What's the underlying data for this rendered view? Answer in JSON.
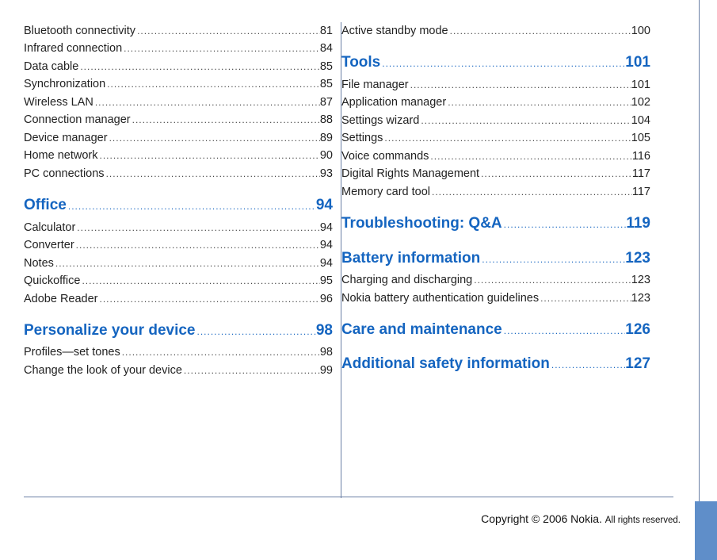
{
  "columns": [
    [
      {
        "label": "Bluetooth connectivity",
        "page": "81"
      },
      {
        "label": "Infrared connection",
        "page": "84"
      },
      {
        "label": "Data cable",
        "page": "85"
      },
      {
        "label": "Synchronization",
        "page": "85"
      },
      {
        "label": "Wireless LAN",
        "page": "87"
      },
      {
        "label": "Connection manager",
        "page": "88"
      },
      {
        "label": "Device manager",
        "page": "89"
      },
      {
        "label": "Home network",
        "page": "90"
      },
      {
        "label": "PC connections",
        "page": "93"
      },
      {
        "label": "Office",
        "page": "94",
        "section": true
      },
      {
        "label": "Calculator",
        "page": "94"
      },
      {
        "label": "Converter",
        "page": "94"
      },
      {
        "label": "Notes",
        "page": "94"
      },
      {
        "label": "Quickoffice",
        "page": "95"
      },
      {
        "label": "Adobe Reader",
        "page": "96"
      },
      {
        "label": "Personalize your device",
        "page": "98",
        "section": true
      },
      {
        "label": "Profiles—set tones",
        "page": "98"
      },
      {
        "label": "Change the look of your device",
        "page": "99"
      }
    ],
    [
      {
        "label": "Active standby mode",
        "page": "100"
      },
      {
        "label": "Tools",
        "page": "101",
        "section": true
      },
      {
        "label": "File manager",
        "page": "101"
      },
      {
        "label": "Application manager",
        "page": "102"
      },
      {
        "label": "Settings wizard",
        "page": "104"
      },
      {
        "label": "Settings",
        "page": "105"
      },
      {
        "label": "Voice commands",
        "page": "116"
      },
      {
        "label": "Digital Rights Management",
        "page": "117"
      },
      {
        "label": "Memory card tool",
        "page": "117"
      },
      {
        "label": "Troubleshooting: Q&A",
        "page": "119",
        "section": true
      },
      {
        "label": "Battery information",
        "page": "123",
        "section": true
      },
      {
        "label": "Charging and discharging",
        "page": "123"
      },
      {
        "label": "Nokia battery authentication guidelines",
        "page": "123"
      },
      {
        "label": "Care and maintenance",
        "page": "126",
        "section": true
      },
      {
        "label": "Additional safety information",
        "page": "127",
        "section": true
      }
    ]
  ],
  "footer": {
    "main": "Copyright © 2006 Nokia.",
    "sub": "All rights reserved."
  }
}
